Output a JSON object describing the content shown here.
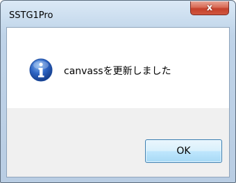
{
  "window": {
    "title": "SSTG1Pro",
    "close_glyph": "x"
  },
  "dialog": {
    "icon": "info-icon",
    "message": "canvassを更新しました",
    "ok_label": "OK"
  },
  "colors": {
    "accent": "#2c63c2",
    "close_button": "#c4402b"
  }
}
